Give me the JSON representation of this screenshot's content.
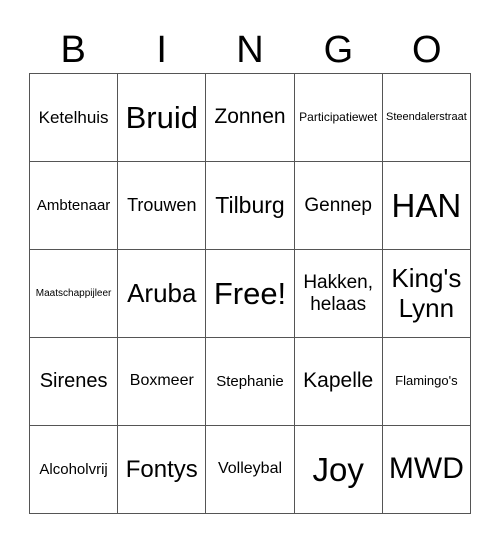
{
  "header": [
    "B",
    "I",
    "N",
    "G",
    "O"
  ],
  "cells": [
    {
      "text": "Ketelhuis"
    },
    {
      "text": "Bruid"
    },
    {
      "text": "Zonnen"
    },
    {
      "text": "Participatiewet"
    },
    {
      "text": "Steendalerstraat"
    },
    {
      "text": "Ambtenaar"
    },
    {
      "text": "Trouwen"
    },
    {
      "text": "Tilburg"
    },
    {
      "text": "Gennep"
    },
    {
      "text": "HAN"
    },
    {
      "text": "Maatschappijleer"
    },
    {
      "text": "Aruba"
    },
    {
      "text": "Free!"
    },
    {
      "text": "Hakken, helaas"
    },
    {
      "text": "King's Lynn"
    },
    {
      "text": "Sirenes"
    },
    {
      "text": "Boxmeer"
    },
    {
      "text": "Stephanie"
    },
    {
      "text": "Kapelle"
    },
    {
      "text": "Flamingo's"
    },
    {
      "text": "Alcoholvrij"
    },
    {
      "text": "Fontys"
    },
    {
      "text": "Volleybal"
    },
    {
      "text": "Joy"
    },
    {
      "text": "MWD"
    }
  ]
}
